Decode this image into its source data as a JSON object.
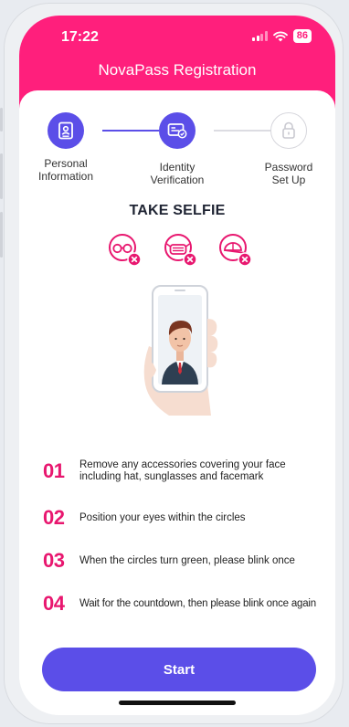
{
  "status_bar": {
    "time": "17:22",
    "battery": "86"
  },
  "header": {
    "title": "NovaPass Registration"
  },
  "stepper": {
    "steps": [
      {
        "label_line1": "Personal",
        "label_line2": "Information",
        "state": "completed",
        "icon": "id-card-icon"
      },
      {
        "label_line1": "Identity",
        "label_line2": "Verification",
        "state": "active",
        "icon": "id-verify-icon"
      },
      {
        "label_line1": "Password",
        "label_line2": "Set Up",
        "state": "inactive",
        "icon": "lock-icon"
      }
    ]
  },
  "selfie": {
    "title": "TAKE SELFIE",
    "avoid_icons": [
      "glasses-not-allowed-icon",
      "facemask-not-allowed-icon",
      "hat-not-allowed-icon"
    ]
  },
  "instructions": [
    {
      "number": "01",
      "text": "Remove any accessories covering your face including hat, sunglasses and facemark"
    },
    {
      "number": "02",
      "text": "Position your eyes within the circles"
    },
    {
      "number": "03",
      "text": "When the circles turn green, please blink once"
    },
    {
      "number": "04",
      "text": "Wait for the countdown, then please blink once again"
    }
  ],
  "actions": {
    "start_label": "Start"
  },
  "colors": {
    "brand_pink": "#ff1f7c",
    "accent_purple": "#5b4ee8",
    "number_pink": "#e8176f"
  }
}
